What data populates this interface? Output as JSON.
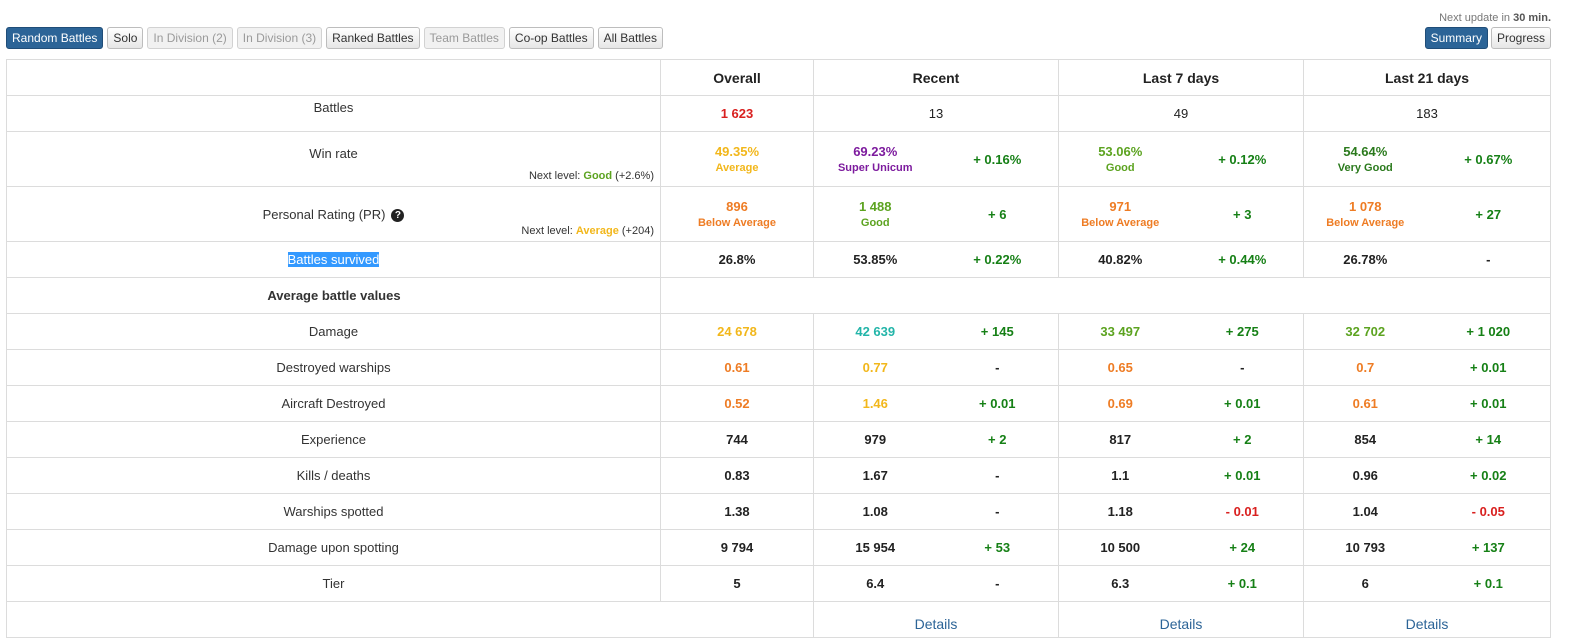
{
  "next_update": {
    "prefix": "Next update in",
    "value": "30 min."
  },
  "filters": [
    {
      "label": "Random Battles",
      "state": "active"
    },
    {
      "label": "Solo",
      "state": "normal"
    },
    {
      "label": "In Division (2)",
      "state": "disabled"
    },
    {
      "label": "In Division (3)",
      "state": "disabled"
    },
    {
      "label": "Ranked Battles",
      "state": "normal"
    },
    {
      "label": "Team Battles",
      "state": "disabled"
    },
    {
      "label": "Co-op Battles",
      "state": "normal"
    },
    {
      "label": "All Battles",
      "state": "normal"
    }
  ],
  "views": [
    {
      "label": "Summary",
      "state": "active"
    },
    {
      "label": "Progress",
      "state": "normal"
    }
  ],
  "headers": {
    "overall": "Overall",
    "recent": "Recent",
    "last7": "Last 7 days",
    "last21": "Last 21 days"
  },
  "battles": {
    "label": "Battles",
    "overall": "1 623",
    "recent": "13",
    "last7": "49",
    "last21": "183"
  },
  "winrate": {
    "label": "Win rate",
    "next_prefix": "Next level:",
    "next_level": "Good",
    "next_delta": "(+2.6%)",
    "overall": {
      "value": "49.35%",
      "tier": "Average"
    },
    "recent": {
      "value": "69.23%",
      "tier": "Super Unicum",
      "delta": "+ 0.16%"
    },
    "last7": {
      "value": "53.06%",
      "tier": "Good",
      "delta": "+ 0.12%"
    },
    "last21": {
      "value": "54.64%",
      "tier": "Very Good",
      "delta": "+ 0.67%"
    }
  },
  "pr": {
    "label": "Personal Rating (PR)",
    "next_prefix": "Next level:",
    "next_level": "Average",
    "next_delta": "(+204)",
    "overall": {
      "value": "896",
      "tier": "Below Average"
    },
    "recent": {
      "value": "1 488",
      "tier": "Good",
      "delta": "+ 6"
    },
    "last7": {
      "value": "971",
      "tier": "Below Average",
      "delta": "+ 3"
    },
    "last21": {
      "value": "1 078",
      "tier": "Below Average",
      "delta": "+ 27"
    }
  },
  "survived": {
    "label": "Battles survived",
    "overall": "26.8%",
    "recent": "53.85%",
    "recent_delta": "+ 0.22%",
    "last7": "40.82%",
    "last7_delta": "+ 0.44%",
    "last21": "26.78%",
    "last21_delta": "-"
  },
  "avg_section": "Average battle values",
  "rows": [
    {
      "label": "Damage",
      "overall": "24 678",
      "recent": "42 639",
      "recent_delta": "+ 145",
      "last7": "33 497",
      "last7_delta": "+ 275",
      "last21": "32 702",
      "last21_delta": "+ 1 020"
    },
    {
      "label": "Destroyed warships",
      "overall": "0.61",
      "recent": "0.77",
      "recent_delta": "-",
      "last7": "0.65",
      "last7_delta": "-",
      "last21": "0.7",
      "last21_delta": "+ 0.01"
    },
    {
      "label": "Aircraft Destroyed",
      "overall": "0.52",
      "recent": "1.46",
      "recent_delta": "+ 0.01",
      "last7": "0.69",
      "last7_delta": "+ 0.01",
      "last21": "0.61",
      "last21_delta": "+ 0.01"
    },
    {
      "label": "Experience",
      "overall": "744",
      "recent": "979",
      "recent_delta": "+ 2",
      "last7": "817",
      "last7_delta": "+ 2",
      "last21": "854",
      "last21_delta": "+ 14"
    },
    {
      "label": "Kills / deaths",
      "overall": "0.83",
      "recent": "1.67",
      "recent_delta": "-",
      "last7": "1.1",
      "last7_delta": "+ 0.01",
      "last21": "0.96",
      "last21_delta": "+ 0.02"
    },
    {
      "label": "Warships spotted",
      "overall": "1.38",
      "recent": "1.08",
      "recent_delta": "-",
      "last7": "1.18",
      "last7_delta": "- 0.01",
      "last21": "1.04",
      "last21_delta": "- 0.05"
    },
    {
      "label": "Damage upon spotting",
      "overall": "9 794",
      "recent": "15 954",
      "recent_delta": "+ 53",
      "last7": "10 500",
      "last7_delta": "+ 24",
      "last21": "10 793",
      "last21_delta": "+ 137"
    },
    {
      "label": "Tier",
      "overall": "5",
      "recent": "6.4",
      "recent_delta": "-",
      "last7": "6.3",
      "last7_delta": "+ 0.1",
      "last21": "6",
      "last21_delta": "+ 0.1"
    }
  ],
  "details": {
    "recent": "Details",
    "last7": "Details",
    "last21": "Details"
  },
  "colors": {
    "accent": "#2c6497",
    "red": "#d9201f",
    "orange": "#ee7c24",
    "yellow": "#f2b71b",
    "green": "#168016",
    "light_green": "#5ca320",
    "purple": "#7d1b9e",
    "teal": "#23b5a9",
    "selection": "#3399ff"
  }
}
